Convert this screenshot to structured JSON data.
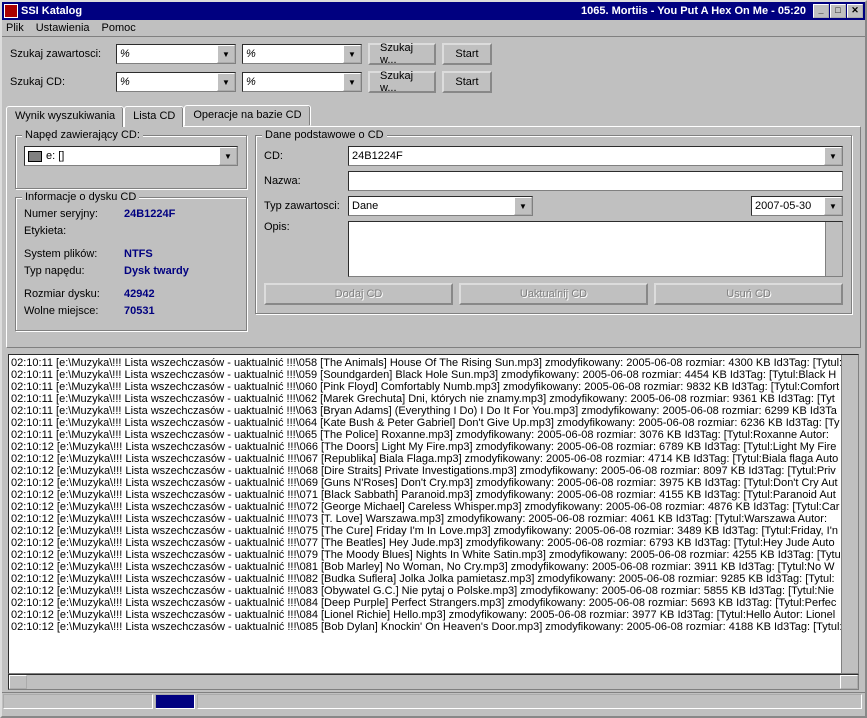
{
  "title": "SSI Katalog",
  "nowplaying": "1065. Mortiis - You Put A Hex On Me - 05:20",
  "menu": {
    "file": "Plik",
    "settings": "Ustawienia",
    "help": "Pomoc"
  },
  "search": {
    "content_label": "Szukaj zawartosci:",
    "cd_label": "Szukaj CD:",
    "combo1": "%",
    "combo2": "%",
    "combo3": "%",
    "combo4": "%",
    "btn_in": "Szukaj w...",
    "btn_start": "Start"
  },
  "tabs": {
    "results": "Wynik wyszukiwania",
    "cdlist": "Lista CD",
    "ops": "Operacje na bazie CD"
  },
  "drive_group": {
    "legend": "Napęd zawierający CD:",
    "value": "e: []"
  },
  "disk_info": {
    "legend": "Informacje o dysku CD",
    "serial_lbl": "Numer seryjny:",
    "serial_val": "24B1224F",
    "label_lbl": "Etykieta:",
    "fs_lbl": "System plików:",
    "fs_val": "NTFS",
    "type_lbl": "Typ napędu:",
    "type_val": "Dysk twardy",
    "size_lbl": "Rozmiar dysku:",
    "size_val": "42942",
    "free_lbl": "Wolne miejsce:",
    "free_val": "70531"
  },
  "cd_data": {
    "legend": "Dane podstawowe o CD",
    "cd_lbl": "CD:",
    "cd_val": "24B1224F",
    "name_lbl": "Nazwa:",
    "name_val": "",
    "type_lbl": "Typ zawartosci:",
    "type_val": "Dane",
    "date_val": "2007-05-30",
    "desc_lbl": "Opis:",
    "btn_add": "Dodaj CD",
    "btn_upd": "Uaktualnij CD",
    "btn_del": "Usuń CD"
  },
  "log": [
    "02:10:11 [e:\\Muzyka\\!!! Lista wszechczasów - uaktualnić !!!\\058 [The Animals] House Of The Rising Sun.mp3] zmodyfikowany: 2005-06-08 rozmiar: 4300 KB  Id3Tag:  [Tytul:",
    "02:10:11 [e:\\Muzyka\\!!! Lista wszechczasów - uaktualnić !!!\\059 [Soundgarden] Black Hole Sun.mp3] zmodyfikowany: 2005-06-08 rozmiar: 4454 KB  Id3Tag:  [Tytul:Black H",
    "02:10:11 [e:\\Muzyka\\!!! Lista wszechczasów - uaktualnić !!!\\060 [Pink Floyd] Comfortably Numb.mp3] zmodyfikowany: 2005-06-08 rozmiar: 9832 KB  Id3Tag:  [Tytul:Comfort",
    "02:10:11 [e:\\Muzyka\\!!! Lista wszechczasów - uaktualnić !!!\\062 [Marek Grechuta] Dni, których nie znamy.mp3] zmodyfikowany: 2005-06-08 rozmiar: 9361 KB  Id3Tag:  [Tyt",
    "02:10:11 [e:\\Muzyka\\!!! Lista wszechczasów - uaktualnić !!!\\063 [Bryan Adams] (Everything I Do) I Do It For You.mp3] zmodyfikowany: 2005-06-08 rozmiar: 6299 KB  Id3Ta",
    "02:10:11 [e:\\Muzyka\\!!! Lista wszechczasów - uaktualnić !!!\\064 [Kate Bush & Peter Gabriel] Don't Give Up.mp3] zmodyfikowany: 2005-06-08 rozmiar: 6236 KB  Id3Tag:  [Ty",
    "02:10:11 [e:\\Muzyka\\!!! Lista wszechczasów - uaktualnić !!!\\065 [The Police] Roxanne.mp3] zmodyfikowany: 2005-06-08 rozmiar: 3076 KB  Id3Tag:  [Tytul:Roxanne Autor:",
    "02:10:12 [e:\\Muzyka\\!!! Lista wszechczasów - uaktualnić !!!\\066 [The Doors] Light My Fire.mp3] zmodyfikowany: 2005-06-08 rozmiar: 6789 KB  Id3Tag:  [Tytul:Light My Fire",
    "02:10:12 [e:\\Muzyka\\!!! Lista wszechczasów - uaktualnić !!!\\067 [Republika] Biala Flaga.mp3] zmodyfikowany: 2005-06-08 rozmiar: 4714 KB  Id3Tag:  [Tytul:Biala flaga Auto",
    "02:10:12 [e:\\Muzyka\\!!! Lista wszechczasów - uaktualnić !!!\\068 [Dire Straits] Private Investigations.mp3] zmodyfikowany: 2005-06-08 rozmiar: 8097 KB  Id3Tag:  [Tytul:Priv",
    "02:10:12 [e:\\Muzyka\\!!! Lista wszechczasów - uaktualnić !!!\\069 [Guns N'Roses] Don't Cry.mp3] zmodyfikowany: 2005-06-08 rozmiar: 3975 KB  Id3Tag:  [Tytul:Don't Cry Aut",
    "02:10:12 [e:\\Muzyka\\!!! Lista wszechczasów - uaktualnić !!!\\071 [Black Sabbath] Paranoid.mp3] zmodyfikowany: 2005-06-08 rozmiar: 4155 KB  Id3Tag:  [Tytul:Paranoid Aut",
    "02:10:12 [e:\\Muzyka\\!!! Lista wszechczasów - uaktualnić !!!\\072 [George Michael] Careless Whisper.mp3] zmodyfikowany: 2005-06-08 rozmiar: 4876 KB  Id3Tag:  [Tytul:Car",
    "02:10:12 [e:\\Muzyka\\!!! Lista wszechczasów - uaktualnić !!!\\073 [T. Love] Warszawa.mp3] zmodyfikowany: 2005-06-08 rozmiar: 4061 KB  Id3Tag:  [Tytul:Warszawa Autor:",
    "02:10:12 [e:\\Muzyka\\!!! Lista wszechczasów - uaktualnić !!!\\075 [The Cure] Friday I'm In Love.mp3] zmodyfikowany: 2005-06-08 rozmiar: 3489 KB  Id3Tag:  [Tytul:Friday, I'n",
    "02:10:12 [e:\\Muzyka\\!!! Lista wszechczasów - uaktualnić !!!\\077 [The Beatles] Hey Jude.mp3] zmodyfikowany: 2005-06-08 rozmiar: 6793 KB  Id3Tag:  [Tytul:Hey Jude Auto",
    "02:10:12 [e:\\Muzyka\\!!! Lista wszechczasów - uaktualnić !!!\\079 [The Moody Blues] Nights In White Satin.mp3] zmodyfikowany: 2005-06-08 rozmiar: 4255 KB  Id3Tag:  [Tytul",
    "02:10:12 [e:\\Muzyka\\!!! Lista wszechczasów - uaktualnić !!!\\081 [Bob Marley] No Woman, No Cry.mp3] zmodyfikowany: 2005-06-08 rozmiar: 3911 KB  Id3Tag:  [Tytul:No W",
    "02:10:12 [e:\\Muzyka\\!!! Lista wszechczasów - uaktualnić !!!\\082 [Budka Suflera] Jolka Jolka pamietasz.mp3] zmodyfikowany: 2005-06-08 rozmiar: 9285 KB  Id3Tag:  [Tytul:",
    "02:10:12 [e:\\Muzyka\\!!! Lista wszechczasów - uaktualnić !!!\\083 [Obywatel G.C.] Nie pytaj o Polske.mp3] zmodyfikowany: 2005-06-08 rozmiar: 5855 KB  Id3Tag:  [Tytul:Nie",
    "02:10:12 [e:\\Muzyka\\!!! Lista wszechczasów - uaktualnić !!!\\084 [Deep Purple] Perfect Strangers.mp3] zmodyfikowany: 2005-06-08 rozmiar: 5693 KB  Id3Tag:  [Tytul:Perfec",
    "02:10:12 [e:\\Muzyka\\!!! Lista wszechczasów - uaktualnić !!!\\084 [Lionel Richie] Hello.mp3] zmodyfikowany: 2005-06-08 rozmiar: 3977 KB  Id3Tag:  [Tytul:Hello Autor: Lionel",
    "02:10:12 [e:\\Muzyka\\!!! Lista wszechczasów - uaktualnić !!!\\085 [Bob Dylan] Knockin' On Heaven's Door.mp3] zmodyfikowany: 2005-06-08 rozmiar: 4188 KB  Id3Tag:  [Tytul:"
  ]
}
